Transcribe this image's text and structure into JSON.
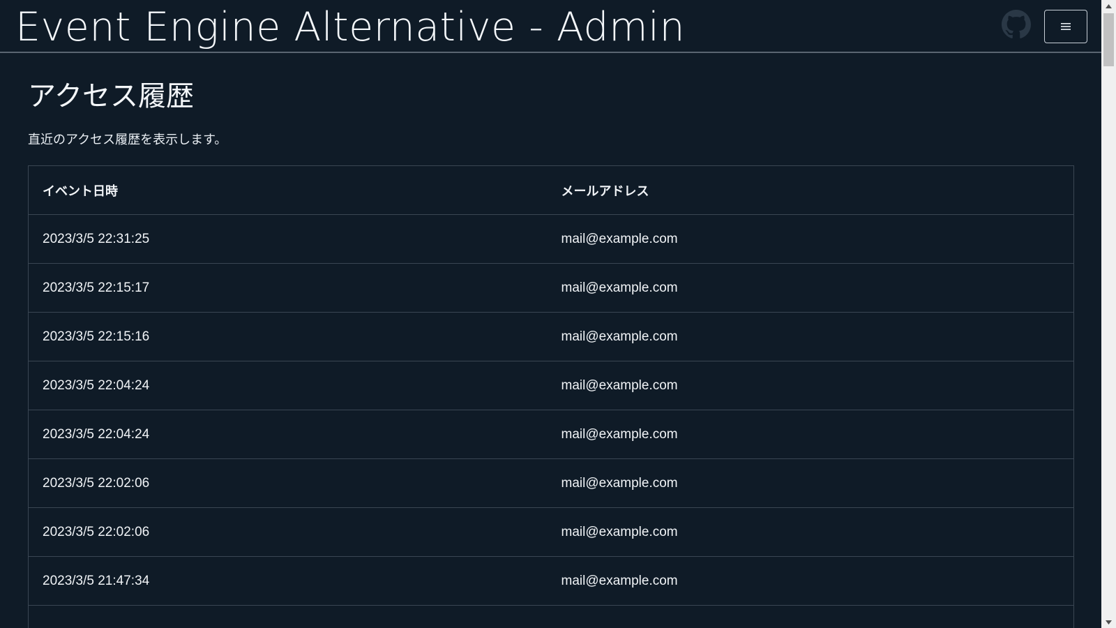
{
  "header": {
    "title": "Event Engine Alternative - Admin",
    "github_icon": "github-icon",
    "menu_icon": "hamburger-menu-icon"
  },
  "main": {
    "title": "アクセス履歴",
    "description": "直近のアクセス履歴を表示します。",
    "table": {
      "columns": [
        "イベント日時",
        "メールアドレス"
      ],
      "rows": [
        [
          "2023/3/5 22:31:25",
          "mail@example.com"
        ],
        [
          "2023/3/5 22:15:17",
          "mail@example.com"
        ],
        [
          "2023/3/5 22:15:16",
          "mail@example.com"
        ],
        [
          "2023/3/5 22:04:24",
          "mail@example.com"
        ],
        [
          "2023/3/5 22:04:24",
          "mail@example.com"
        ],
        [
          "2023/3/5 22:02:06",
          "mail@example.com"
        ],
        [
          "2023/3/5 22:02:06",
          "mail@example.com"
        ],
        [
          "2023/3/5 21:47:34",
          "mail@example.com"
        ],
        [
          "",
          ""
        ]
      ]
    }
  },
  "colors": {
    "background": "#0f1b27",
    "text": "#f1f4f7",
    "border": "#3a4653"
  }
}
